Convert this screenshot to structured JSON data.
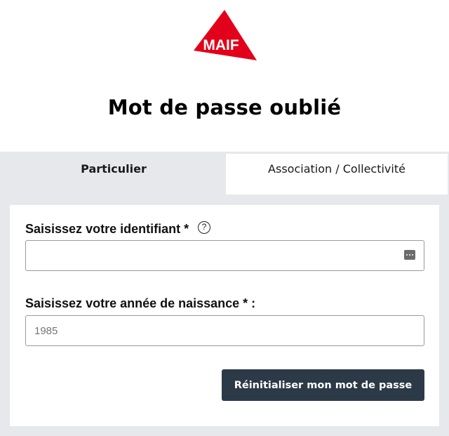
{
  "logo": {
    "text": "MAIF",
    "color": "#e3001b"
  },
  "page": {
    "title": "Mot de passe oublié"
  },
  "tabs": [
    {
      "label": "Particulier",
      "active": true
    },
    {
      "label": "Association / Collectivité",
      "active": false
    }
  ],
  "form": {
    "identifiant": {
      "label": "Saisissez votre identifiant *",
      "help_icon": "?",
      "value": "",
      "placeholder": "",
      "trailing_icon": "password-dots-icon"
    },
    "annee": {
      "label": "Saisissez votre année de naissance * :",
      "value": "",
      "placeholder": "1985"
    },
    "submit_label": "Réinitialiser mon mot de passe"
  },
  "colors": {
    "button_bg": "#2c3a47",
    "panel_bg": "#e6e8eb",
    "brand_red": "#e3001b"
  }
}
